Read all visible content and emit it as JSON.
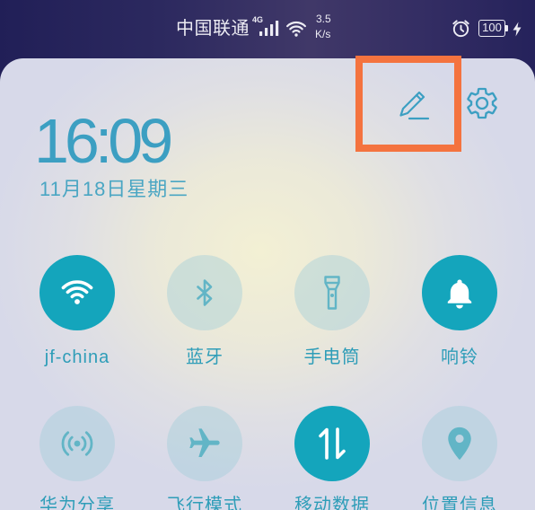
{
  "status_bar": {
    "carrier": "中国联通",
    "network_type": "4G",
    "speed": {
      "value": "3.5",
      "unit": "K/s"
    },
    "battery_level": "100",
    "icons": {
      "signal": "signal-bars-icon",
      "wifi": "wifi-icon",
      "alarm": "alarm-clock-icon",
      "battery": "battery-icon",
      "charging": "charging-bolt-icon"
    }
  },
  "notification_panel": {
    "time": "16:09",
    "date": "11月18日星期三",
    "header_icons": {
      "edit": "pencil-icon",
      "settings": "gear-icon"
    },
    "toggles": [
      {
        "label": "jf-china",
        "icon": "wifi-icon",
        "active": true
      },
      {
        "label": "蓝牙",
        "icon": "bluetooth-icon",
        "active": false
      },
      {
        "label": "手电筒",
        "icon": "flashlight-icon",
        "active": false
      },
      {
        "label": "响铃",
        "icon": "bell-icon",
        "active": true
      },
      {
        "label": "华为分享",
        "icon": "huawei-share-icon",
        "active": false
      },
      {
        "label": "飞行模式",
        "icon": "airplane-icon",
        "active": false
      },
      {
        "label": "移动数据",
        "icon": "mobile-data-icon",
        "active": true
      },
      {
        "label": "位置信息",
        "icon": "location-pin-icon",
        "active": false
      }
    ]
  },
  "colors": {
    "status_bar_bg": "#2a275e",
    "accent": "#3c9fc2",
    "tile_on": "#14a5bc",
    "tile_icon_off": "#62b5c6",
    "label": "#2e9db8",
    "highlight": "#f4733f"
  }
}
